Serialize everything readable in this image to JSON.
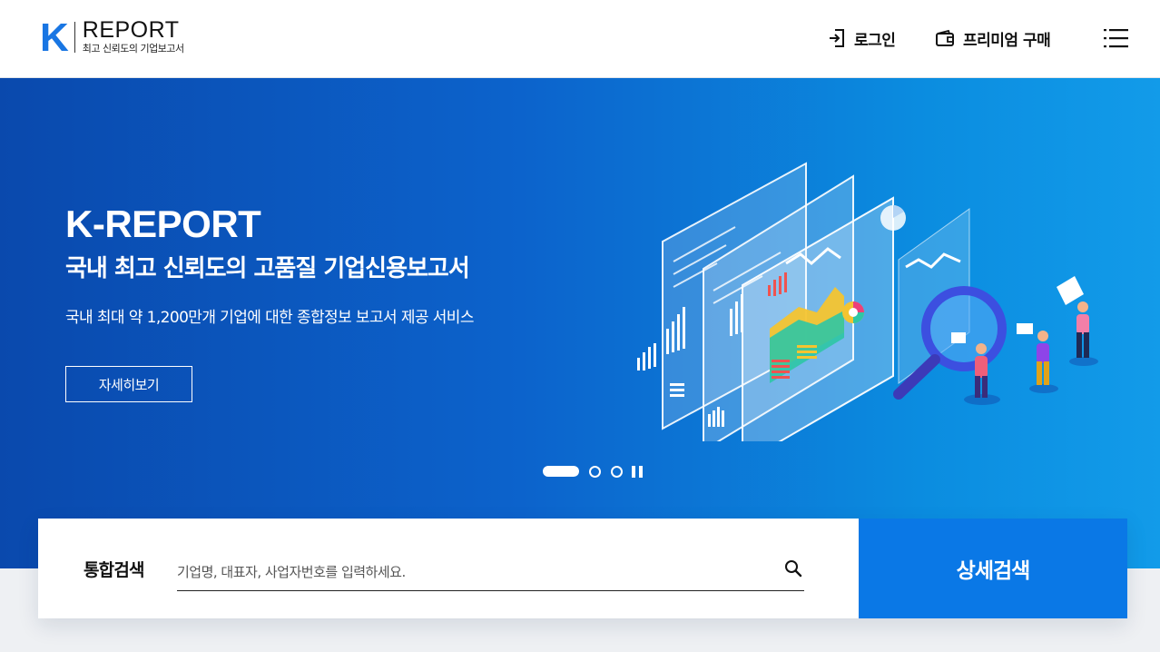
{
  "header": {
    "logo": {
      "mark": "K",
      "title": "REPORT",
      "subtitle": "최고 신뢰도의 기업보고서"
    },
    "nav": {
      "login_label": "로그인",
      "premium_label": "프리미엄 구매"
    },
    "icons": {
      "login": "login-icon",
      "premium": "wallet-icon",
      "menu": "hamburger-menu-icon"
    }
  },
  "hero": {
    "title": "K-REPORT",
    "subtitle": "국내 최고 신뢰도의 고품질 기업신용보고서",
    "description": "국내 최대 약 1,200만개 기업에 대한 종합정보 보고서 제공 서비스",
    "button_label": "자세히보기",
    "slider": {
      "total_slides": 3,
      "active_slide": 1,
      "pause_icon": "pause-icon"
    },
    "illustration": "isometric-data-dashboard-illustration"
  },
  "search": {
    "label": "통합검색",
    "placeholder": "기업명, 대표자, 사업자번호를 입력하세요.",
    "value": "",
    "search_icon": "search-icon",
    "detail_button_label": "상세검색"
  },
  "colors": {
    "brand": "#1976e3",
    "hero_gradient_start": "#0a49ad",
    "hero_gradient_end": "#129be9",
    "detail_button": "#0a78e6"
  }
}
